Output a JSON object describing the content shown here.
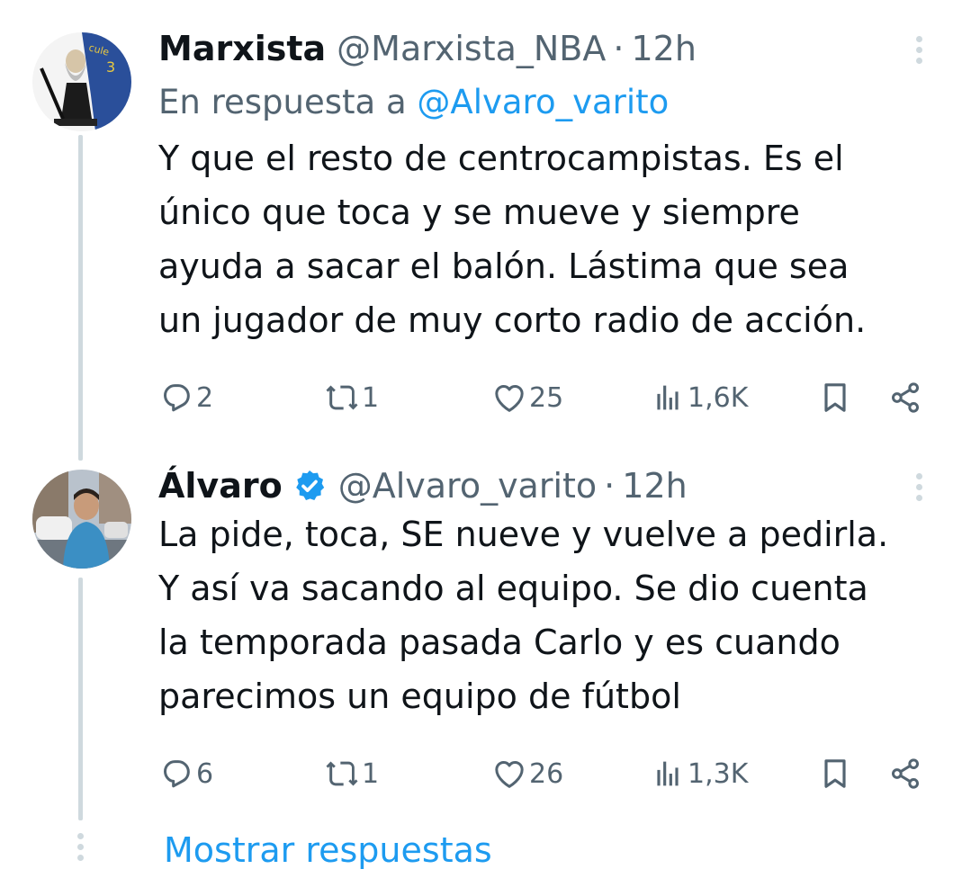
{
  "thread": [
    {
      "name": "Marxista",
      "handle": "@Marxista_NBA",
      "separator": "·",
      "time": "12h",
      "verified": false,
      "reply_to_prefix": "En respuesta a ",
      "reply_to_handle": "@Alvaro_varito",
      "text_lines": [
        "Y que el resto de centrocampistas. Es el",
        "único que toca y se mueve y siempre",
        "ayuda a sacar el balón. Lástima que sea",
        "un jugador de muy corto radio de acción."
      ],
      "replies": "2",
      "retweets": "1",
      "likes": "25",
      "views": "1,6K"
    },
    {
      "name": "Álvaro",
      "handle": "@Alvaro_varito",
      "separator": "·",
      "time": "12h",
      "verified": true,
      "text_lines": [
        "La pide, toca, SE nueve y vuelve a pedirla.",
        "Y así va sacando al equipo. Se dio cuenta",
        "la temporada pasada Carlo y es cuando",
        "parecimos un equipo de fútbol"
      ],
      "replies": "6",
      "retweets": "1",
      "likes": "26",
      "views": "1,3K"
    }
  ],
  "show_replies_label": "Mostrar respuestas",
  "colors": {
    "accent": "#1d9bf0",
    "secondary_text": "#536471",
    "thread_line": "#cfd9de"
  },
  "icons": {
    "reply": "reply-icon",
    "retweet": "retweet-icon",
    "like": "heart-icon",
    "views": "views-icon",
    "bookmark": "bookmark-icon",
    "share": "share-icon",
    "more": "more-icon",
    "verified": "verified-badge-icon"
  }
}
